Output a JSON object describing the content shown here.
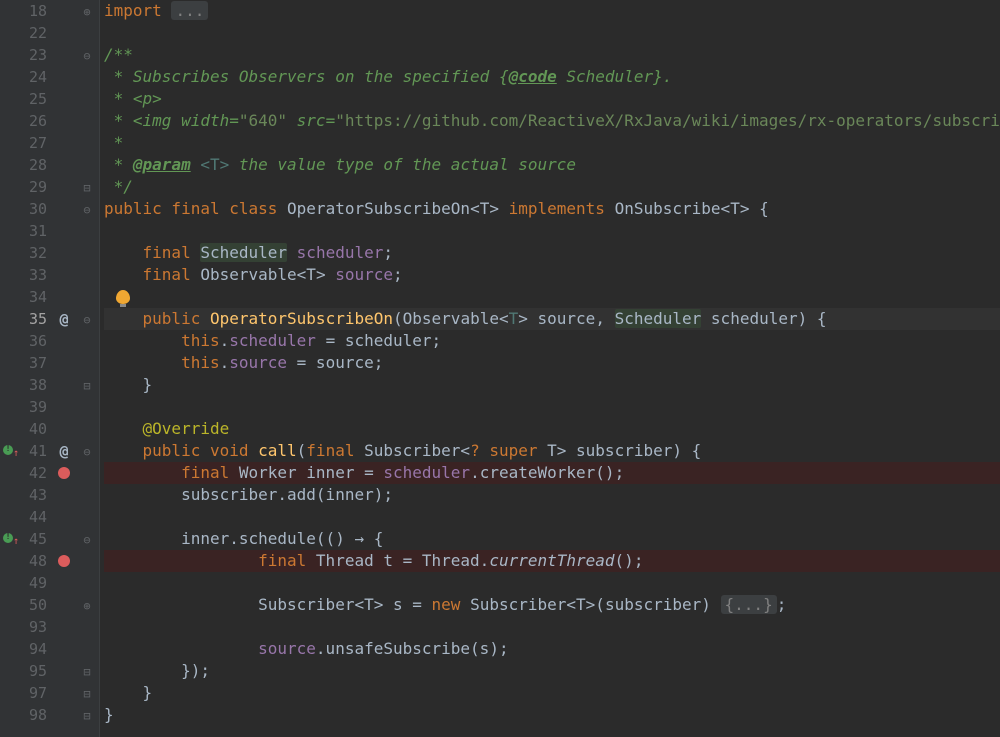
{
  "lines": [
    {
      "num": "18",
      "fold": "close",
      "marker": "",
      "tokens": [
        [
          "kw",
          "import "
        ],
        [
          "fold-ellipsis",
          "..."
        ]
      ]
    },
    {
      "num": "22",
      "tokens": []
    },
    {
      "num": "23",
      "fold": "open",
      "tokens": [
        [
          "doc",
          "/**"
        ]
      ]
    },
    {
      "num": "24",
      "tokens": [
        [
          "doc",
          " * Subscribes Observers on the specified {"
        ],
        [
          "doctag",
          "@code"
        ],
        [
          "doc",
          " Scheduler}."
        ]
      ]
    },
    {
      "num": "25",
      "tokens": [
        [
          "doc",
          " * <p>"
        ]
      ]
    },
    {
      "num": "26",
      "tokens": [
        [
          "doc",
          " * <img width="
        ],
        [
          "str",
          "\"640\""
        ],
        [
          "doc",
          " src="
        ],
        [
          "str",
          "\"https://github.com/ReactiveX/RxJava/wiki/images/rx-operators/subscri"
        ]
      ]
    },
    {
      "num": "27",
      "tokens": [
        [
          "doc",
          " *"
        ]
      ]
    },
    {
      "num": "28",
      "tokens": [
        [
          "doc",
          " * "
        ],
        [
          "doctag",
          "@param"
        ],
        [
          "doc",
          " "
        ],
        [
          "gen",
          "<T>"
        ],
        [
          "doc",
          " the value type of the actual source"
        ]
      ]
    },
    {
      "num": "29",
      "fold": "end",
      "tokens": [
        [
          "doc",
          " */"
        ]
      ]
    },
    {
      "num": "30",
      "fold": "open",
      "tokens": [
        [
          "kw",
          "public final class "
        ],
        [
          "cls",
          "OperatorSubscribeOn"
        ],
        [
          "op",
          "<"
        ],
        [
          "type",
          "T"
        ],
        [
          "op",
          "> "
        ],
        [
          "kw",
          "implements "
        ],
        [
          "type",
          "OnSubscribe"
        ],
        [
          "op",
          "<"
        ],
        [
          "type",
          "T"
        ],
        [
          "op",
          "> {"
        ]
      ]
    },
    {
      "num": "31",
      "tokens": []
    },
    {
      "num": "32",
      "tokens": [
        [
          "op",
          "    "
        ],
        [
          "kw",
          "final "
        ],
        [
          "hlg",
          "Scheduler"
        ],
        [
          "op",
          " "
        ],
        [
          "field",
          "scheduler"
        ],
        [
          "op",
          ";"
        ]
      ]
    },
    {
      "num": "33",
      "tokens": [
        [
          "op",
          "    "
        ],
        [
          "kw",
          "final "
        ],
        [
          "type",
          "Observable"
        ],
        [
          "op",
          "<"
        ],
        [
          "type",
          "T"
        ],
        [
          "op",
          "> "
        ],
        [
          "field",
          "source"
        ],
        [
          "op",
          ";"
        ]
      ]
    },
    {
      "num": "34",
      "bulb": true,
      "tokens": []
    },
    {
      "num": "35",
      "current": true,
      "marker": "@",
      "fold": "open",
      "tokens": [
        [
          "op",
          "    "
        ],
        [
          "kw",
          "public "
        ],
        [
          "method",
          "OperatorSubscribeOn"
        ],
        [
          "op",
          "("
        ],
        [
          "type",
          "Observable"
        ],
        [
          "op",
          "<"
        ],
        [
          "gen",
          "T"
        ],
        [
          "op",
          "> "
        ],
        [
          "param",
          "source"
        ],
        [
          "op",
          ", "
        ],
        [
          "hlg",
          "Scheduler"
        ],
        [
          "op",
          " "
        ],
        [
          "param",
          "scheduler"
        ],
        [
          "op",
          ") {"
        ]
      ]
    },
    {
      "num": "36",
      "tokens": [
        [
          "op",
          "        "
        ],
        [
          "kw",
          "this"
        ],
        [
          "op",
          "."
        ],
        [
          "field",
          "scheduler"
        ],
        [
          "op",
          " = scheduler;"
        ]
      ]
    },
    {
      "num": "37",
      "tokens": [
        [
          "op",
          "        "
        ],
        [
          "kw",
          "this"
        ],
        [
          "op",
          "."
        ],
        [
          "field",
          "source"
        ],
        [
          "op",
          " = source;"
        ]
      ]
    },
    {
      "num": "38",
      "fold": "end",
      "tokens": [
        [
          "op",
          "    }"
        ]
      ]
    },
    {
      "num": "39",
      "tokens": []
    },
    {
      "num": "40",
      "tokens": [
        [
          "op",
          "    "
        ],
        [
          "ann",
          "@Override"
        ]
      ]
    },
    {
      "num": "41",
      "marker": "diff",
      "marker2": "@",
      "fold": "open",
      "tokens": [
        [
          "op",
          "    "
        ],
        [
          "kw",
          "public void "
        ],
        [
          "method",
          "call"
        ],
        [
          "op",
          "("
        ],
        [
          "kw",
          "final "
        ],
        [
          "type",
          "Subscriber"
        ],
        [
          "op",
          "<"
        ],
        [
          "kw",
          "? super "
        ],
        [
          "type",
          "T"
        ],
        [
          "op",
          "> subscriber) {"
        ]
      ]
    },
    {
      "num": "42",
      "marker": "bp",
      "bp": true,
      "tokens": [
        [
          "op",
          "        "
        ],
        [
          "kw",
          "final "
        ],
        [
          "type",
          "Worker"
        ],
        [
          "op",
          " inner = "
        ],
        [
          "field",
          "scheduler"
        ],
        [
          "op",
          "."
        ],
        [
          "ident",
          "createWorker"
        ],
        [
          "op",
          "();"
        ]
      ]
    },
    {
      "num": "43",
      "tokens": [
        [
          "op",
          "        subscriber.add(inner);"
        ]
      ]
    },
    {
      "num": "44",
      "tokens": []
    },
    {
      "num": "45",
      "marker": "diff",
      "fold": "open",
      "tokens": [
        [
          "op",
          "        inner.schedule(() "
        ],
        [
          "arrow",
          "→"
        ],
        [
          "op",
          " {"
        ]
      ]
    },
    {
      "num": "48",
      "marker": "bp",
      "bp": true,
      "tokens": [
        [
          "op",
          "                "
        ],
        [
          "kw",
          "final "
        ],
        [
          "type",
          "Thread"
        ],
        [
          "op",
          " t = Thread."
        ],
        [
          "italic",
          "currentThread"
        ],
        [
          "op",
          "();"
        ]
      ]
    },
    {
      "num": "49",
      "tokens": []
    },
    {
      "num": "50",
      "fold": "close",
      "tokens": [
        [
          "op",
          "                "
        ],
        [
          "type",
          "Subscriber"
        ],
        [
          "op",
          "<"
        ],
        [
          "type",
          "T"
        ],
        [
          "op",
          "> s = "
        ],
        [
          "kw",
          "new "
        ],
        [
          "type",
          "Subscriber"
        ],
        [
          "op",
          "<"
        ],
        [
          "type",
          "T"
        ],
        [
          "op",
          ">(subscriber) "
        ],
        [
          "fold-ellipsis",
          "{...}"
        ],
        [
          "op",
          ";"
        ]
      ]
    },
    {
      "num": "93",
      "tokens": []
    },
    {
      "num": "94",
      "tokens": [
        [
          "op",
          "                "
        ],
        [
          "field",
          "source"
        ],
        [
          "op",
          ".unsafeSubscribe(s);"
        ]
      ]
    },
    {
      "num": "95",
      "fold": "end",
      "tokens": [
        [
          "op",
          "        });"
        ]
      ]
    },
    {
      "num": "97",
      "fold": "end",
      "tokens": [
        [
          "op",
          "    }"
        ]
      ]
    },
    {
      "num": "98",
      "fold": "end",
      "tokens": [
        [
          "op",
          "}"
        ]
      ]
    }
  ]
}
